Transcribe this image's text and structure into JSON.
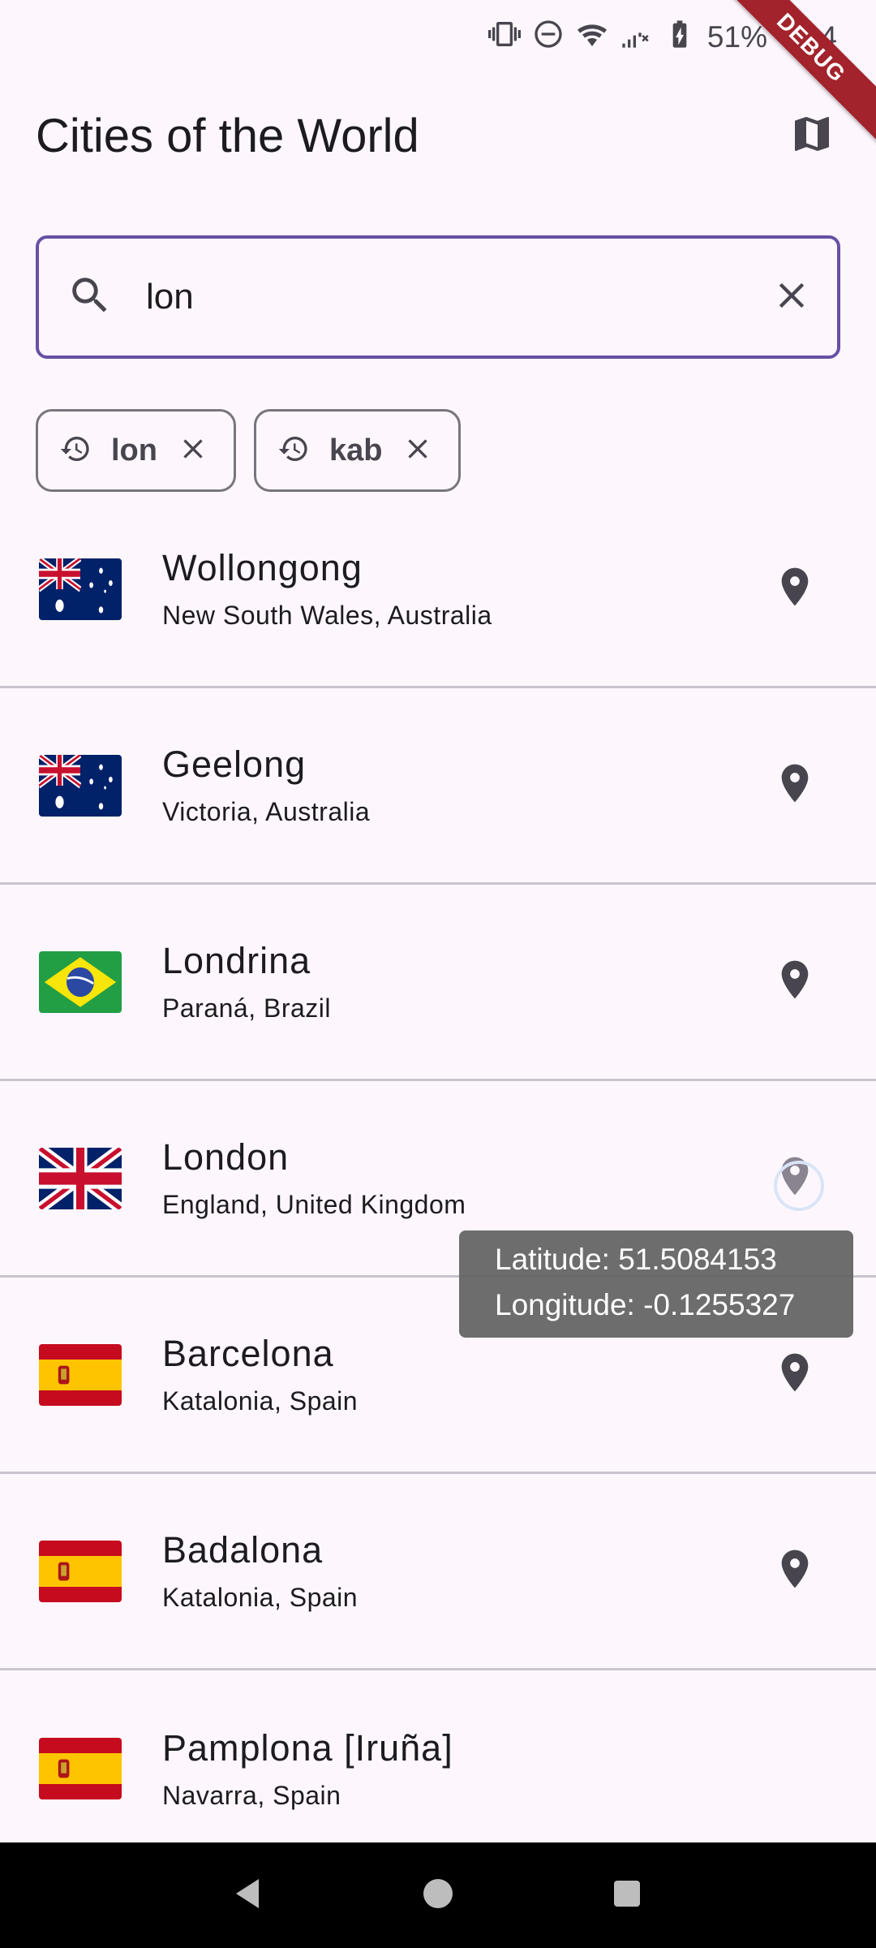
{
  "status_bar": {
    "battery_pct": "51%",
    "time": "4:04"
  },
  "debug_banner": "DEBUG",
  "app_bar": {
    "title": "Cities of the World",
    "map_icon": "map-icon"
  },
  "search": {
    "value": "lon",
    "placeholder": ""
  },
  "recent_searches": [
    {
      "label": "lon"
    },
    {
      "label": "kab"
    }
  ],
  "cities": [
    {
      "name": "Wollongong",
      "region": "New South Wales, Australia",
      "flag": "australia-flag"
    },
    {
      "name": "Geelong",
      "region": "Victoria, Australia",
      "flag": "australia-flag"
    },
    {
      "name": "Londrina",
      "region": "Paraná, Brazil",
      "flag": "brazil-flag"
    },
    {
      "name": "London",
      "region": "England, United Kingdom",
      "flag": "uk-flag"
    },
    {
      "name": "Barcelona",
      "region": "Katalonia, Spain",
      "flag": "spain-flag"
    },
    {
      "name": "Badalona",
      "region": "Katalonia, Spain",
      "flag": "spain-flag"
    },
    {
      "name": "Pamplona [Iruña]",
      "region": "Navarra, Spain",
      "flag": "spain-flag"
    }
  ],
  "tooltip": {
    "latitude": "Latitude: 51.5084153",
    "longitude": "Longitude: -0.1255327"
  },
  "colors": {
    "accent": "#6750a4",
    "background": "#fdf7fd",
    "debug_banner": "#a2232b"
  }
}
